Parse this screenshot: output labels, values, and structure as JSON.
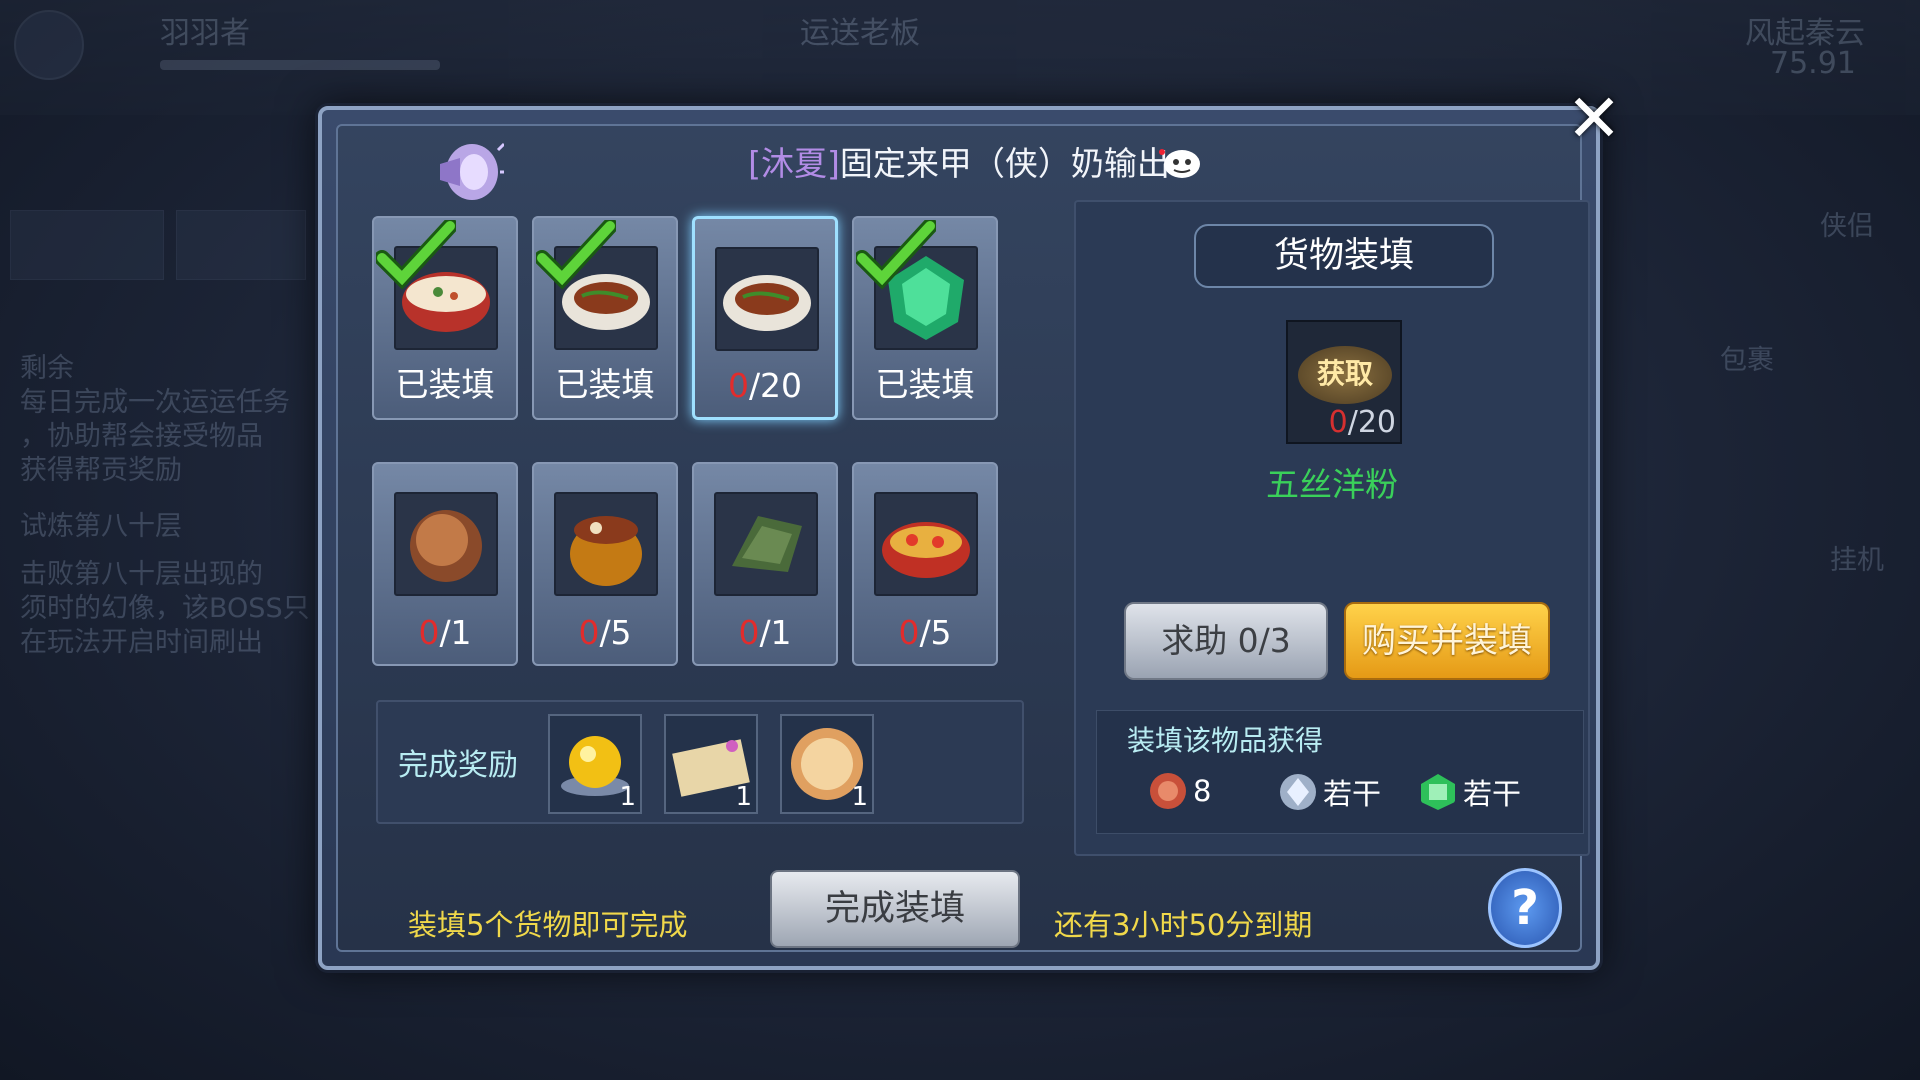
{
  "background": {
    "top_names": [
      "羽羽者",
      "运送老板",
      "风起秦云"
    ],
    "top_number": "75.91",
    "left_lines": [
      "剩余",
      "每日完成一次运运任务",
      "，协助帮会接受物品",
      "获得帮贡奖励",
      "试炼第八十层",
      "击败第八十层出现的",
      "须时的幻像，该BOSS只",
      "在玩法开启时间刷出"
    ],
    "right_lines": [
      "侠侣",
      "包裹",
      "挂机"
    ]
  },
  "dialog": {
    "title_tag": "[沐夏]",
    "title_text": "固定来甲（侠）奶输出",
    "close_icon": "close-icon"
  },
  "slots": [
    {
      "status": "已装填",
      "filled": true,
      "food": "porridge"
    },
    {
      "status": "已装填",
      "filled": true,
      "food": "noodles"
    },
    {
      "current": "0",
      "total": "/20",
      "filled": false,
      "food": "noodles",
      "selected": true
    },
    {
      "status": "已装填",
      "filled": true,
      "food": "jade"
    },
    {
      "current": "0",
      "total": "/1",
      "filled": false,
      "food": "bun"
    },
    {
      "current": "0",
      "total": "/5",
      "filled": false,
      "food": "jar"
    },
    {
      "current": "0",
      "total": "/1",
      "filled": false,
      "food": "leaf"
    },
    {
      "current": "0",
      "total": "/5",
      "filled": false,
      "food": "soup"
    }
  ],
  "reward": {
    "label": "完成奖励",
    "items": [
      {
        "icon": "gold-orb-icon",
        "count": "1"
      },
      {
        "icon": "scroll-icon",
        "count": "1"
      },
      {
        "icon": "pancake-icon",
        "count": "1"
      }
    ]
  },
  "right_panel": {
    "title": "货物装填",
    "acquire_label": "获取",
    "target_current": "0",
    "target_total": "/20",
    "item_name": "五丝洋粉",
    "help_button": "求助 0/3",
    "buy_button": "购买并装填",
    "gain_title": "装填该物品获得",
    "gains": [
      {
        "icon": "copper-coin-icon",
        "value": "8"
      },
      {
        "icon": "silver-coin-icon",
        "value": "若干"
      },
      {
        "icon": "guild-token-icon",
        "value": "若干"
      }
    ]
  },
  "footer": {
    "left_text": "装填5个货物即可完成",
    "complete_button": "完成装填",
    "right_text": "还有3小时50分到期",
    "help_icon": "?"
  },
  "colors": {
    "accent_gold": "#f0d84a",
    "item_green": "#3ad05a",
    "count_red": "#e22c2c",
    "buy_orange": "#e59a16"
  }
}
